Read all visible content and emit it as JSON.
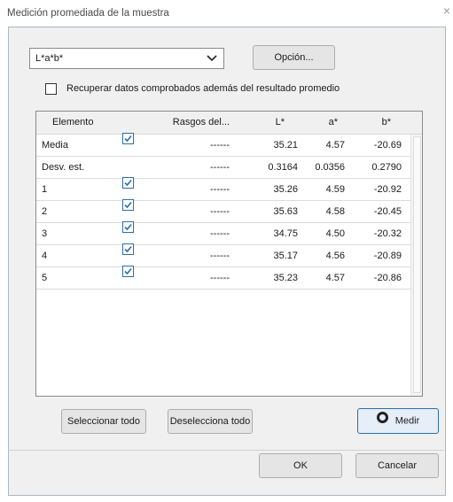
{
  "window": {
    "title": "Medición promediada de la muestra"
  },
  "color_space": {
    "selected": "L*a*b*"
  },
  "buttons": {
    "option": "Opción...",
    "select_all": "Seleccionar todo",
    "deselect_all": "Deselecciona todo",
    "measure": "Medir",
    "ok": "OK",
    "cancel": "Cancelar"
  },
  "retrieve_checkbox": {
    "label": "Recuperar datos comprobados además del resultado promedio",
    "checked": false
  },
  "table": {
    "headers": [
      "Elemento",
      "",
      "Rasgos del...",
      "L*",
      "a*",
      "b*"
    ],
    "rows": [
      {
        "element": "Media",
        "checked": true,
        "rasgos": "------",
        "L": "35.21",
        "a": "4.57",
        "b": "-20.69"
      },
      {
        "element": "Desv. est.",
        "checked": false,
        "rasgos": "------",
        "L": "0.3164",
        "a": "0.0356",
        "b": "0.2790"
      },
      {
        "element": "1",
        "checked": true,
        "rasgos": "------",
        "L": "35.26",
        "a": "4.59",
        "b": "-20.92"
      },
      {
        "element": "2",
        "checked": true,
        "rasgos": "------",
        "L": "35.63",
        "a": "4.58",
        "b": "-20.45"
      },
      {
        "element": "3",
        "checked": true,
        "rasgos": "------",
        "L": "34.75",
        "a": "4.50",
        "b": "-20.32"
      },
      {
        "element": "4",
        "checked": true,
        "rasgos": "------",
        "L": "35.17",
        "a": "4.56",
        "b": "-20.89"
      },
      {
        "element": "5",
        "checked": true,
        "rasgos": "------",
        "L": "35.23",
        "a": "4.57",
        "b": "-20.86"
      }
    ]
  },
  "colors": {
    "accent": "#2c6fa8",
    "dialog_bg": "#f0f0f0"
  }
}
